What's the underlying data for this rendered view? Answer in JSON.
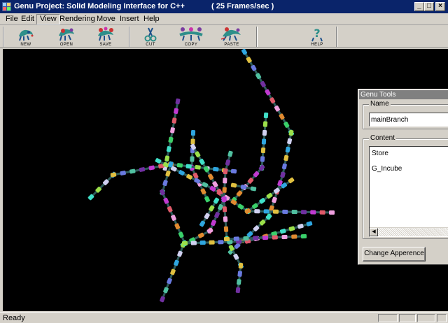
{
  "window": {
    "title": "Genu Project: Solid Modeling Interface for C++",
    "fps": "( 25 Frames/sec )",
    "minimize": "_",
    "maximize": "□",
    "close": "×"
  },
  "menu": [
    "File",
    "Edit",
    "View",
    "Rendering",
    "Move",
    "Insert",
    "Help"
  ],
  "toolbar": {
    "new": "NEW",
    "open": "OPEN",
    "save": "SAVE",
    "cut": "CUT",
    "copy": "COPY",
    "paste": "PASTE",
    "help": "HELP"
  },
  "tools_panel": {
    "title": "Genu Tools",
    "name_label": "Name",
    "name_value": "mainBranch",
    "content_label": "Content",
    "content_items": [
      "Store",
      "G_Incube"
    ],
    "appearance_button": "Change Apperence"
  },
  "status": "Ready",
  "colors": {
    "titlebar": "#0a246a",
    "face": "#d4d0c8",
    "viewport": "#000000"
  }
}
